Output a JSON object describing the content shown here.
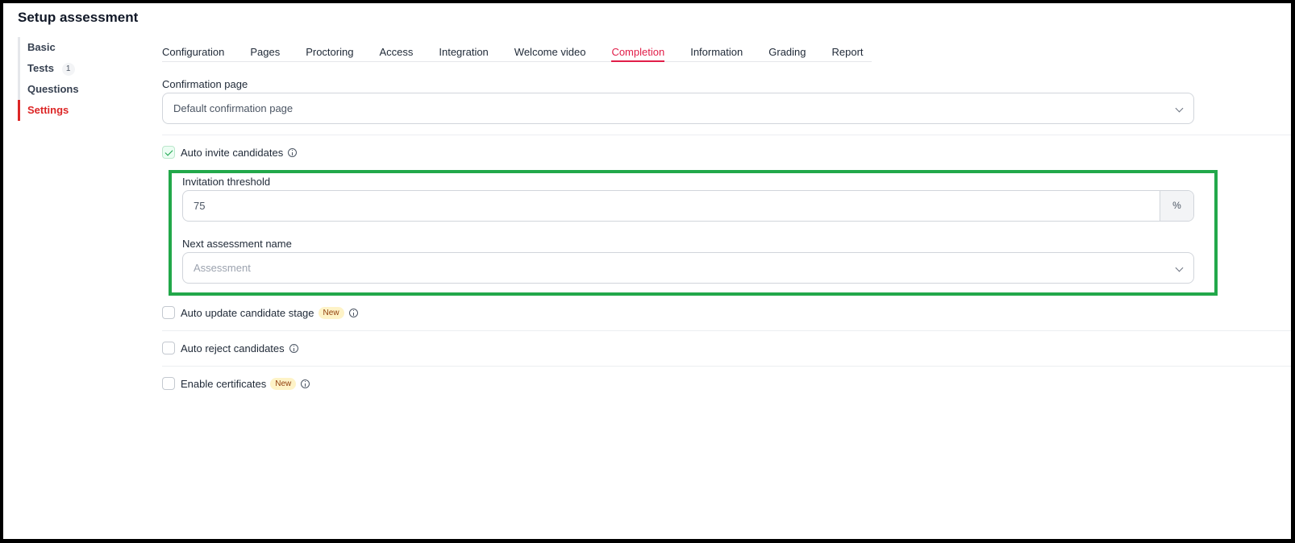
{
  "page": {
    "title": "Setup assessment"
  },
  "sidebar": {
    "items": [
      {
        "label": "Basic",
        "active": false
      },
      {
        "label": "Tests",
        "badge": "1",
        "active": false
      },
      {
        "label": "Questions",
        "active": false
      },
      {
        "label": "Settings",
        "active": true
      }
    ]
  },
  "tabs": [
    {
      "label": "Configuration"
    },
    {
      "label": "Pages"
    },
    {
      "label": "Proctoring"
    },
    {
      "label": "Access"
    },
    {
      "label": "Integration"
    },
    {
      "label": "Welcome video"
    },
    {
      "label": "Completion",
      "active": true
    },
    {
      "label": "Information"
    },
    {
      "label": "Grading"
    },
    {
      "label": "Report"
    }
  ],
  "completion": {
    "confirmation_page": {
      "label": "Confirmation page",
      "value": "Default confirmation page"
    },
    "auto_invite": {
      "label": "Auto invite candidates",
      "checked": true,
      "threshold": {
        "label": "Invitation threshold",
        "value": "75",
        "suffix": "%"
      },
      "next_assessment": {
        "label": "Next assessment name",
        "placeholder": "Assessment"
      }
    },
    "auto_update_stage": {
      "label": "Auto update candidate stage",
      "badge": "New",
      "checked": false
    },
    "auto_reject": {
      "label": "Auto reject candidates",
      "checked": false
    },
    "certificates": {
      "label": "Enable certificates",
      "badge": "New",
      "checked": false
    }
  },
  "colors": {
    "accent": "#e11d48",
    "sidebar_active": "#dc2626",
    "highlight": "#22a84a",
    "new_badge_bg": "#fef3c7"
  },
  "icons": [
    "check-icon",
    "info-icon",
    "chevron-down-icon"
  ]
}
